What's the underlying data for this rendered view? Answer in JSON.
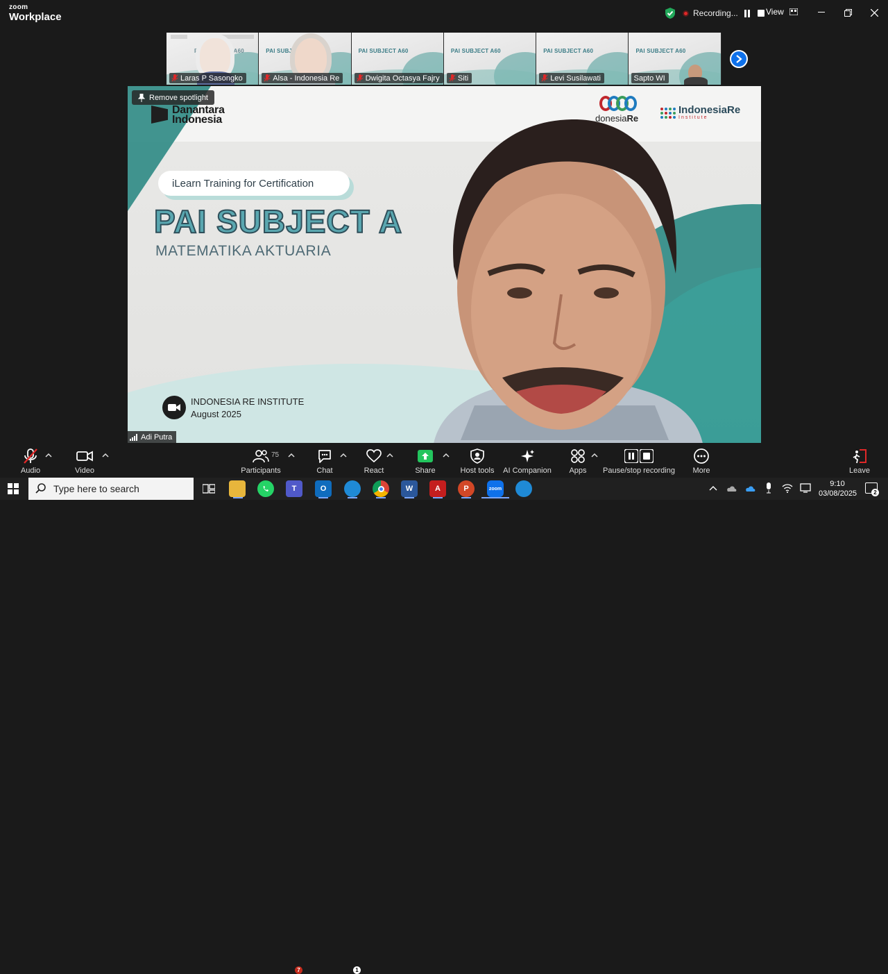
{
  "window": {
    "brand_top": "zoom",
    "brand_bottom": "Workplace",
    "recording_label": "Recording...",
    "view_label": "View",
    "accent": "#0e71eb",
    "recording_color": "#e02828",
    "shield_color": "#22a85a"
  },
  "gallery": {
    "thumbnails": [
      {
        "name": "Laras P Sasongko",
        "title": "PAI SUBJECT A60"
      },
      {
        "name": "Alsa - Indonesia Re",
        "title": "PAI SUBJECT"
      },
      {
        "name": "Dwigita Octasya Fajry",
        "title": "PAI SUBJECT A60"
      },
      {
        "name": "Siti",
        "title": "PAI SUBJECT A60"
      },
      {
        "name": "Levi Susilawati",
        "title": "PAI SUBJECT A60"
      },
      {
        "name": "Sapto WI",
        "title": "PAI SUBJECT A60"
      }
    ]
  },
  "spotlight": {
    "remove_label": "Remove spotlight",
    "presenter_name": "Adi Putra",
    "slide": {
      "org_left": [
        "Danantara",
        "Indonesia"
      ],
      "org_right_1": "IndonesiaRe",
      "org_right_1_prefix": "donesia",
      "org_right_1_suffix": "Re",
      "org_right_2": "IndonesiaRe",
      "org_right_2_sub": "Institute",
      "tag": "iLearn Training for Certification",
      "title": "PAI SUBJECT A",
      "subtitle": "MATEMATIKA AKTUARIA",
      "institute": "INDONESIA RE INSTITUTE",
      "date": "August 2025"
    }
  },
  "toolbar": {
    "audio": "Audio",
    "video": "Video",
    "participants": "Participants",
    "participants_count": "75",
    "chat": "Chat",
    "react": "React",
    "share": "Share",
    "host_tools": "Host tools",
    "ai_companion": "AI Companion",
    "apps": "Apps",
    "pause_recording": "Pause/stop recording",
    "more": "More",
    "leave": "Leave",
    "share_color": "#23c55e",
    "leave_color": "#e02828"
  },
  "taskbar": {
    "search_placeholder": "Type here to search",
    "teams_badge": "7",
    "edge_badge": "1",
    "time": "9:10",
    "date": "03/08/2025",
    "notifications": "2"
  }
}
